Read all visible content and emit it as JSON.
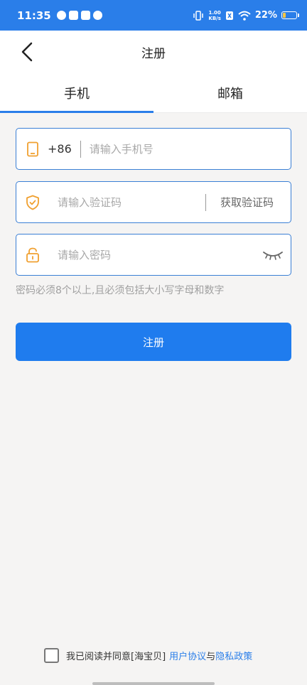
{
  "status_bar": {
    "time": "11:35",
    "net_speed_value": "1.00",
    "net_speed_unit": "KB/s",
    "battery": "22%",
    "battery_level": 0.22
  },
  "header": {
    "title": "注册"
  },
  "tabs": [
    {
      "label": "手机",
      "active": true
    },
    {
      "label": "邮箱",
      "active": false
    }
  ],
  "form": {
    "phone": {
      "country_code": "+86",
      "placeholder": "请输入手机号"
    },
    "code": {
      "placeholder": "请输入验证码",
      "get_code_label": "获取验证码"
    },
    "password": {
      "placeholder": "请输入密码"
    },
    "password_hint": "密码必须8个以上,且必须包括大小写字母和数字",
    "submit_label": "注册"
  },
  "agreement": {
    "prefix": "我已阅读并同意[海宝贝]",
    "user_agreement": "用户协议",
    "and": "与",
    "privacy_policy": "隐私政策",
    "checked": false
  },
  "colors": {
    "accent": "#2a7ee9",
    "button": "#1f7cee",
    "icon_orange": "#f0a030",
    "field_border": "#3a7fd5"
  }
}
